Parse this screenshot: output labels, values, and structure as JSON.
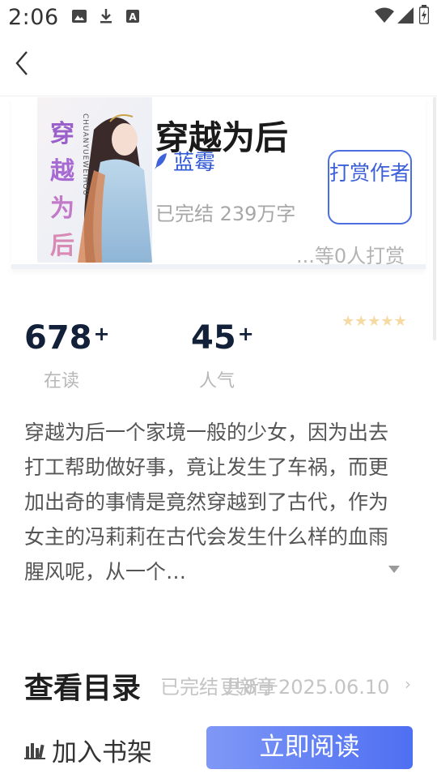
{
  "status_bar": {
    "time": "2:06",
    "icons": [
      "image-icon",
      "download-icon",
      "font-a-icon",
      "wifi-icon",
      "signal-icon",
      "battery-icon"
    ]
  },
  "app_bar": {
    "back_icon": "chevron-left-icon"
  },
  "book": {
    "cover": {
      "title_chars": [
        "穿",
        "越",
        "为",
        "后"
      ],
      "pinyin": "CHUANYUEWEIHOU"
    },
    "title": "穿越为后",
    "author": "蓝霉",
    "status_words": "已完结 239万字",
    "reward_button": "打赏作者",
    "reward_count": "...等0人打赏"
  },
  "stats": {
    "reading": {
      "value": "678",
      "suffix": "+",
      "label": "在读"
    },
    "popularity": {
      "value": "45",
      "suffix": "+",
      "label": "人气"
    },
    "rating_stars": 5
  },
  "description": "穿越为后一个家境一般的少女，因为出去打工帮助做好事，竟让发生了车祸，而更加出奇的事情是竟然穿越到了古代，作为女主的冯莉莉在古代会发生什么样的血雨腥风呢，从一个…",
  "catalog": {
    "title": "查看目录",
    "status": "已完结 共8章",
    "update": "更新于2025.06.10"
  },
  "bottom_bar": {
    "shelf_label": "加入书架",
    "read_label": "立即阅读"
  },
  "colors": {
    "accent_blue": "#3a5fd8",
    "read_button_gradient": [
      "#7f98f6",
      "#4e6ff2"
    ],
    "star": "#f6d9a3",
    "stat_number": "#12203a"
  }
}
